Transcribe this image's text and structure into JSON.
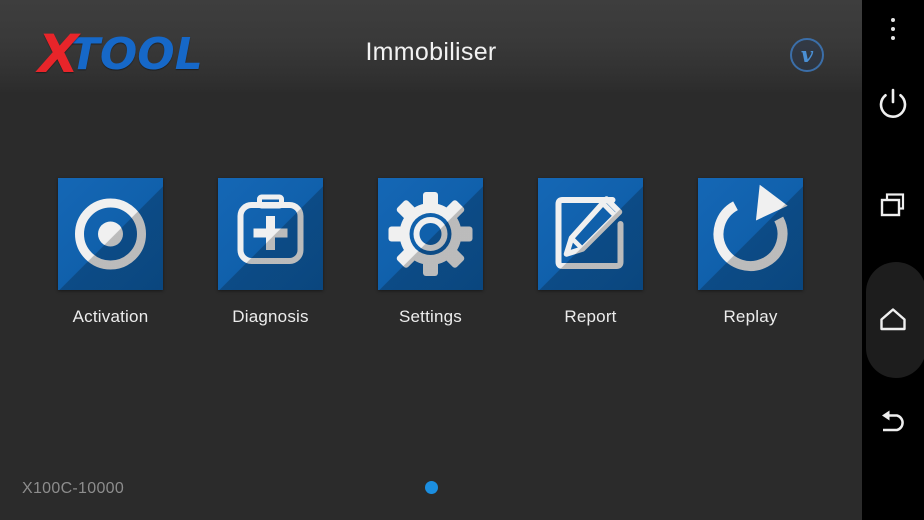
{
  "app": {
    "title": "Immobiliser",
    "brand": {
      "logo_x": "X",
      "logo_tool": "TOOL",
      "color_x": "#e8252a",
      "color_tool": "#1668c8"
    },
    "badge": {
      "icon": "vimeo-v-icon",
      "glyph": "v",
      "color": "#4a8fd4"
    }
  },
  "grid": {
    "items": [
      {
        "label": "Activation",
        "icon": "target-dot-icon"
      },
      {
        "label": "Diagnosis",
        "icon": "first-aid-kit-icon"
      },
      {
        "label": "Settings",
        "icon": "gear-icon"
      },
      {
        "label": "Report",
        "icon": "pencil-edit-square-icon"
      },
      {
        "label": "Replay",
        "icon": "refresh-clockwise-icon"
      }
    ]
  },
  "footer": {
    "serial": "X100C-10000",
    "pages": {
      "count": 1,
      "active": 1,
      "active_color": "#1b8ee0"
    }
  },
  "navbar": {
    "buttons": [
      {
        "name": "overflow-menu",
        "icon": "three-dots-vertical-icon"
      },
      {
        "name": "power",
        "icon": "power-icon"
      },
      {
        "name": "recents",
        "icon": "recents-squares-icon"
      },
      {
        "name": "home",
        "icon": "home-icon"
      },
      {
        "name": "back",
        "icon": "back-arrow-icon"
      }
    ]
  },
  "theme": {
    "background": "#2b2b2b",
    "header": "#3a3a3a",
    "tile_blue": "#1060ab",
    "navbar": "#000000"
  }
}
